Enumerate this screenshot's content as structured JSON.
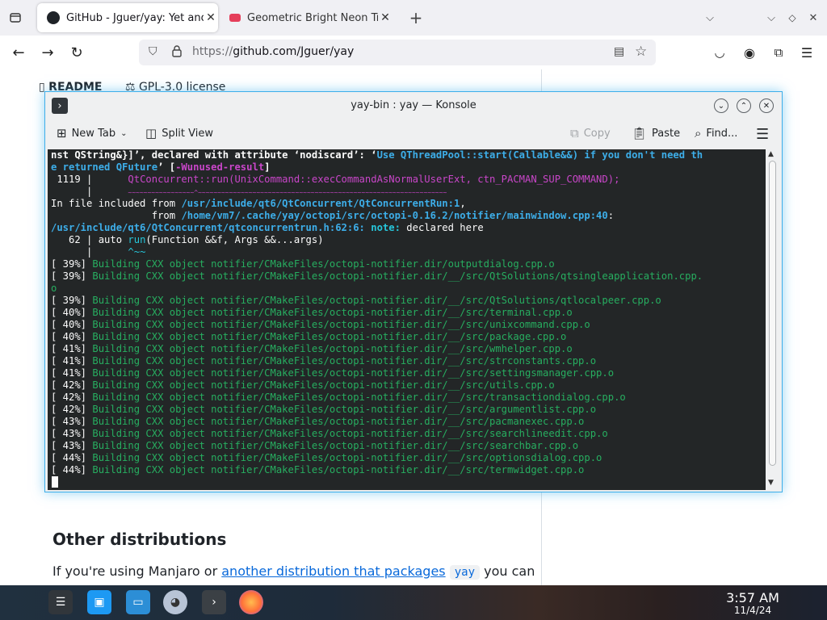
{
  "browser": {
    "tabs": [
      {
        "title": "GitHub - Jguer/yay: Yet another",
        "icon": "github-icon"
      },
      {
        "title": "Geometric Bright Neon Tr",
        "icon": "youtube-icon"
      }
    ],
    "url_scheme": "https://",
    "url_host": "github.com/Jguer/yay"
  },
  "page": {
    "readme_tab": "README",
    "license_tab": "GPL-3.0 license",
    "heading": "Other distributions",
    "para_prefix": "If you're using Manjaro or ",
    "para_link": "another distribution that packages",
    "para_code": "yay",
    "para_suffix": " you can"
  },
  "konsole": {
    "title": "yay-bin : yay — Konsole",
    "toolbar": {
      "new_tab": "New Tab",
      "split_view": "Split View",
      "copy": "Copy",
      "paste": "Paste",
      "find": "Find..."
    },
    "lines": {
      "l1a": "nst QString&}]’, declared with attribute ‘nodiscard’: ‘",
      "l1b": "Use QThreadPool::start(Callable&&) if you don't need th",
      "l2a": "e returned QFuture",
      "l2b": "’ [",
      "l2c": "-Wunused-result",
      "l2d": "]",
      "l3a": " 1119 |      ",
      "l3b": "QtConcurrent::run(UnixCommand::execCommandAsNormalUserExt, ctn_PACMAN_SUP_COMMAND);",
      "l4a": "      |      ",
      "l4b": "~~~~~~~~~~~~~~~~~^~~~~~~~~~~~~~~~~~~~~~~~~~~~~~~~~~~~~~~~~~~~~~~~~~~~~~~~~~~~~~~~~",
      "l5a": "In file included from ",
      "l5b": "/usr/include/qt6/QtConcurrent/QtConcurrentRun:1",
      "l5c": ",",
      "l6a": "                 from ",
      "l6b": "/home/vm7/.cache/yay/octopi/src/octopi-0.16.2/notifier/mainwindow.cpp:40",
      "l6c": ":",
      "l7a": "/usr/include/qt6/QtConcurrent/qtconcurrentrun.h:62:6:",
      "l7b": " note: ",
      "l7c": "declared here",
      "l8a": "   62 | auto ",
      "l8b": "run",
      "l8c": "(Function &&f, Args &&...args)",
      "l9a": "      |      ",
      "l9b": "^~~",
      "build": [
        {
          "pct": "[ 39%] ",
          "text": "Building CXX object notifier/CMakeFiles/octopi-notifier.dir/outputdialog.cpp.o"
        },
        {
          "pct": "[ 39%] ",
          "text": "Building CXX object notifier/CMakeFiles/octopi-notifier.dir/__/src/QtSolutions/qtsingleapplication.cpp."
        },
        {
          "pct": "",
          "text": "o"
        },
        {
          "pct": "[ 39%] ",
          "text": "Building CXX object notifier/CMakeFiles/octopi-notifier.dir/__/src/QtSolutions/qtlocalpeer.cpp.o"
        },
        {
          "pct": "[ 40%] ",
          "text": "Building CXX object notifier/CMakeFiles/octopi-notifier.dir/__/src/terminal.cpp.o"
        },
        {
          "pct": "[ 40%] ",
          "text": "Building CXX object notifier/CMakeFiles/octopi-notifier.dir/__/src/unixcommand.cpp.o"
        },
        {
          "pct": "[ 40%] ",
          "text": "Building CXX object notifier/CMakeFiles/octopi-notifier.dir/__/src/package.cpp.o"
        },
        {
          "pct": "[ 41%] ",
          "text": "Building CXX object notifier/CMakeFiles/octopi-notifier.dir/__/src/wmhelper.cpp.o"
        },
        {
          "pct": "[ 41%] ",
          "text": "Building CXX object notifier/CMakeFiles/octopi-notifier.dir/__/src/strconstants.cpp.o"
        },
        {
          "pct": "[ 41%] ",
          "text": "Building CXX object notifier/CMakeFiles/octopi-notifier.dir/__/src/settingsmanager.cpp.o"
        },
        {
          "pct": "[ 42%] ",
          "text": "Building CXX object notifier/CMakeFiles/octopi-notifier.dir/__/src/utils.cpp.o"
        },
        {
          "pct": "[ 42%] ",
          "text": "Building CXX object notifier/CMakeFiles/octopi-notifier.dir/__/src/transactiondialog.cpp.o"
        },
        {
          "pct": "[ 42%] ",
          "text": "Building CXX object notifier/CMakeFiles/octopi-notifier.dir/__/src/argumentlist.cpp.o"
        },
        {
          "pct": "[ 43%] ",
          "text": "Building CXX object notifier/CMakeFiles/octopi-notifier.dir/__/src/pacmanexec.cpp.o"
        },
        {
          "pct": "[ 43%] ",
          "text": "Building CXX object notifier/CMakeFiles/octopi-notifier.dir/__/src/searchlineedit.cpp.o"
        },
        {
          "pct": "[ 43%] ",
          "text": "Building CXX object notifier/CMakeFiles/octopi-notifier.dir/__/src/searchbar.cpp.o"
        },
        {
          "pct": "[ 44%] ",
          "text": "Building CXX object notifier/CMakeFiles/octopi-notifier.dir/__/src/optionsdialog.cpp.o"
        },
        {
          "pct": "[ 44%] ",
          "text": "Building CXX object notifier/CMakeFiles/octopi-notifier.dir/__/src/termwidget.cpp.o"
        }
      ]
    }
  },
  "taskbar": {
    "time": "3:57 AM",
    "date": "11/4/24"
  },
  "colors": {
    "konsole_bg": "#232627",
    "terminal_green": "#27ae60",
    "terminal_magenta": "#c946c9",
    "terminal_blue": "#3daee9",
    "window_focus": "#3daee9",
    "link": "#0969da"
  }
}
